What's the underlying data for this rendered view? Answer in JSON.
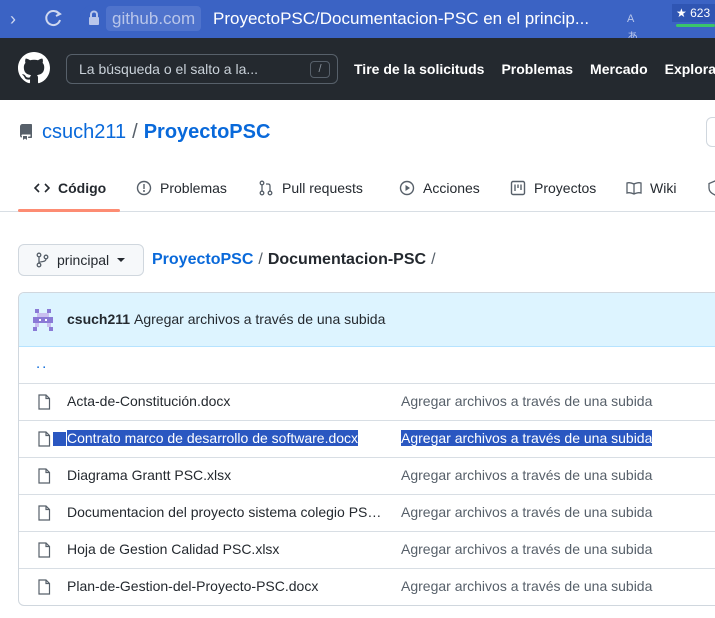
{
  "browser": {
    "url_host": "github.com",
    "url_rest": "ProyectoPSC/Documentacion-PSC en el princip...",
    "translate_glyph": "Aあ",
    "star_count": "623"
  },
  "header": {
    "search_placeholder": "La búsqueda o el salto a la...",
    "search_shortcut": "/",
    "nav": [
      "Tire de la solicituds",
      "Problemas",
      "Mercado",
      "Explorar"
    ]
  },
  "repo": {
    "owner": "csuch211",
    "separator": "/",
    "name": "ProyectoPSC"
  },
  "tabs": [
    {
      "label": "Código",
      "icon": "code-icon",
      "active": true
    },
    {
      "label": "Problemas",
      "icon": "issue-icon"
    },
    {
      "label": "Pull requests",
      "icon": "pull-request-icon"
    },
    {
      "label": "Acciones",
      "icon": "play-icon"
    },
    {
      "label": "Proyectos",
      "icon": "project-icon"
    },
    {
      "label": "Wiki",
      "icon": "book-icon"
    }
  ],
  "branch": {
    "label": "principal"
  },
  "breadcrumb": {
    "repo": "ProyectoPSC",
    "sep": "/",
    "dir": "Documentacion-PSC",
    "trail": "/"
  },
  "commit": {
    "author": "csuch211",
    "message": "Agregar archivos a través de una subida"
  },
  "parent_link": "..",
  "files": [
    {
      "name": "Acta-de-Constitución.docx",
      "commit": "Agregar archivos a través de una subida",
      "selected": false
    },
    {
      "name": "Contrato marco de desarrollo de software.docx",
      "commit": "Agregar archivos a través de una subida",
      "selected": true
    },
    {
      "name": "Diagrama Grantt PSC.xlsx",
      "commit": "Agregar archivos a través de una subida",
      "selected": false
    },
    {
      "name": "Documentacion del proyecto sistema colegio PS…",
      "commit": "Agregar archivos a través de una subida",
      "selected": false
    },
    {
      "name": "Hoja de Gestion Calidad PSC.xlsx",
      "commit": "Agregar archivos a través de una subida",
      "selected": false
    },
    {
      "name": "Plan-de-Gestion-del-Proyecto-PSC.docx",
      "commit": "Agregar archivos a través de una subida",
      "selected": false
    }
  ],
  "colors": {
    "link": "#0969da",
    "header_bg": "#24292f",
    "active_tab": "#fd8c73",
    "selection": "#2a57c1"
  }
}
